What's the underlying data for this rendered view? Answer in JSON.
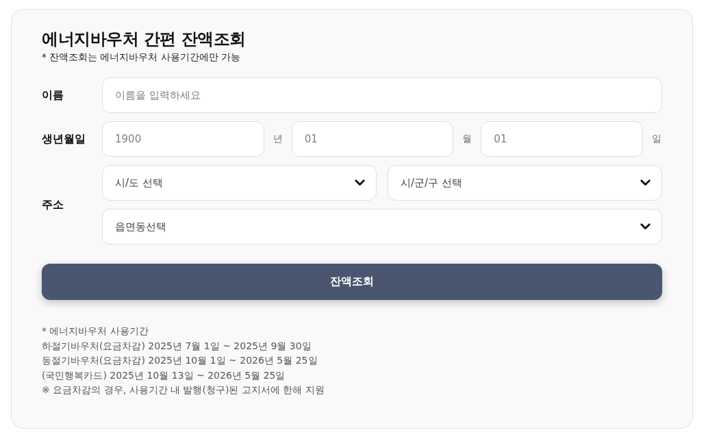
{
  "title": "에너지바우처 간편 잔액조회",
  "subtitle": "* 잔액조회는 에너지바우처 사용기간에만 가능",
  "form": {
    "name": {
      "label": "이름",
      "placeholder": "이름을 입력하세요"
    },
    "birth": {
      "label": "생년월일",
      "fields": [
        {
          "placeholder": "1900",
          "unit": "년"
        },
        {
          "placeholder": "01",
          "unit": "월"
        },
        {
          "placeholder": "01",
          "unit": "일"
        }
      ]
    },
    "address": {
      "label": "주소",
      "rows": [
        [
          {
            "value": "시/도 선택"
          },
          {
            "value": "시/군/구 선택"
          }
        ],
        [
          {
            "value": "읍면동선택"
          }
        ]
      ]
    }
  },
  "submit_button": "잔액조회",
  "notes": [
    "* 에너지바우처 사용기간",
    "하절기바우처(요금차감) 2025년 7월 1일 ~ 2025년 9월 30일",
    "동절기바우처(요금차감) 2025년 10월 1일 ~ 2026년 5월 25일",
    "(국민행복카드) 2025년 10월 13일 ~ 2026년 5월 25일",
    "※ 요금차감의 경우, 사용기간 내 발행(청구)된 고지서에 한해 지원"
  ]
}
